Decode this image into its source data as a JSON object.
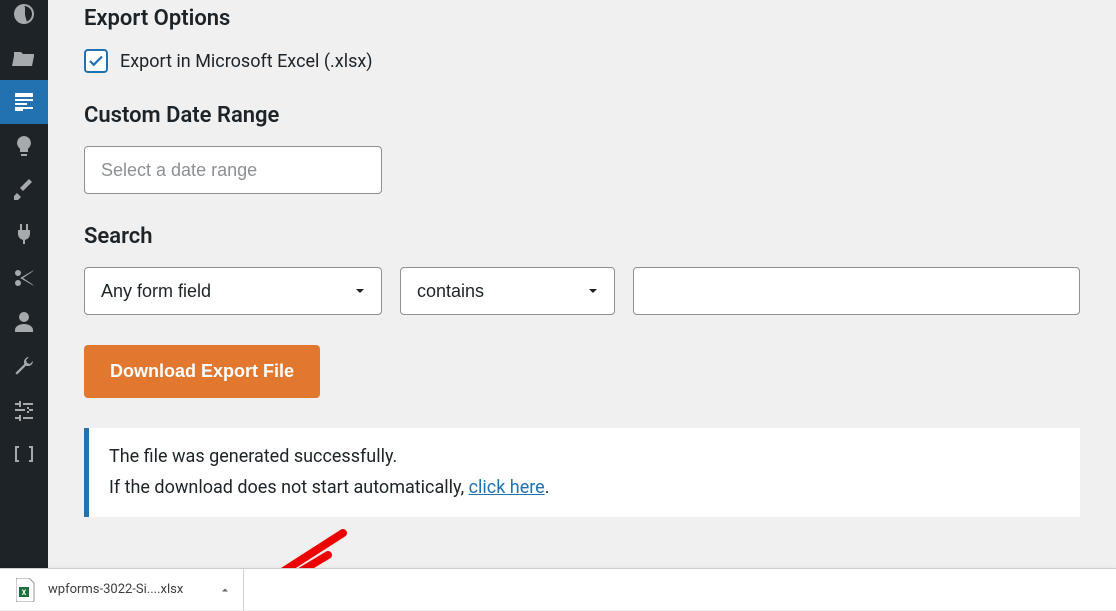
{
  "export_options": {
    "heading": "Export Options",
    "checkbox_label": "Export in Microsoft Excel (.xlsx)",
    "checked": true
  },
  "date_range": {
    "heading": "Custom Date Range",
    "placeholder": "Select a date range"
  },
  "search": {
    "heading": "Search",
    "field_select": "Any form field",
    "operator_select": "contains",
    "value": ""
  },
  "download_button": "Download Export File",
  "notice": {
    "line1": "The file was generated successfully.",
    "line2_prefix": "If the download does not start automatically, ",
    "link_text": "click here",
    "line2_suffix": "."
  },
  "download_bar": {
    "filename": "wpforms-3022-Si....xlsx"
  },
  "sidebar": {
    "items": [
      {
        "name": "dashboard",
        "icon": "dashboard"
      },
      {
        "name": "media",
        "icon": "folder-open"
      },
      {
        "name": "wpforms",
        "icon": "form",
        "active": true
      },
      {
        "name": "ideas",
        "icon": "lightbulb"
      },
      {
        "name": "appearance",
        "icon": "brush"
      },
      {
        "name": "plugins",
        "icon": "plug"
      },
      {
        "name": "snippets",
        "icon": "scissors"
      },
      {
        "name": "users",
        "icon": "user"
      },
      {
        "name": "tools",
        "icon": "wrench"
      },
      {
        "name": "settings",
        "icon": "sliders"
      },
      {
        "name": "code",
        "icon": "brackets"
      }
    ]
  }
}
